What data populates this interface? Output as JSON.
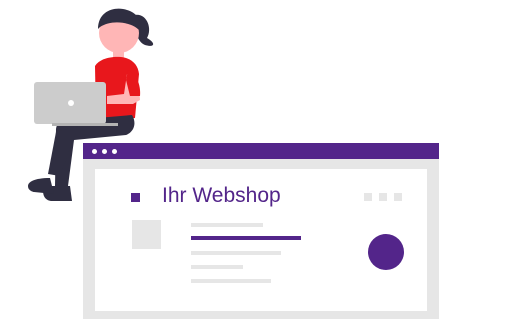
{
  "illustration": {
    "webshop_title": "Ihr Webshop",
    "colors": {
      "accent": "#53258a",
      "placeholder": "#e6e6e6",
      "shirt": "#e8171c",
      "hair": "#2f2e41",
      "skin": "#ffb6b6",
      "laptop": "#cccccc"
    },
    "icons": [
      "person-with-laptop",
      "browser-window-dots"
    ]
  }
}
